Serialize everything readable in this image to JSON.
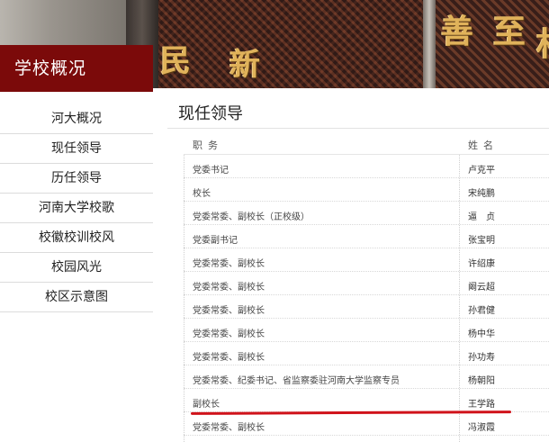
{
  "banner": {
    "glyphs": [
      "民",
      "新",
      "善",
      "至",
      "村"
    ]
  },
  "sidebar": {
    "title": "学校概况",
    "items": [
      {
        "label": "河大概况"
      },
      {
        "label": "现任领导"
      },
      {
        "label": "历任领导"
      },
      {
        "label": "河南大学校歌"
      },
      {
        "label": "校徽校训校风"
      },
      {
        "label": "校园风光"
      },
      {
        "label": "校区示意图"
      }
    ]
  },
  "main": {
    "title": "现任领导",
    "table": {
      "headers": {
        "position": "职务",
        "name": "姓名"
      },
      "rows": [
        {
          "position": "党委书记",
          "name": "卢克平"
        },
        {
          "position": "校长",
          "name": "宋纯鹏"
        },
        {
          "position": "党委常委、副校长（正校级）",
          "name": "逼　贞"
        },
        {
          "position": "党委副书记",
          "name": "张宝明"
        },
        {
          "position": "党委常委、副校长",
          "name": "许绍康"
        },
        {
          "position": "党委常委、副校长",
          "name": "阚云超"
        },
        {
          "position": "党委常委、副校长",
          "name": "孙君健"
        },
        {
          "position": "党委常委、副校长",
          "name": "杨中华"
        },
        {
          "position": "党委常委、副校长",
          "name": "孙功寿"
        },
        {
          "position": "党委常委、纪委书记、省监察委驻河南大学监察专员",
          "name": "杨朝阳"
        },
        {
          "position": "副校长",
          "name": "王学路"
        },
        {
          "position": "党委常委、副校长",
          "name": "冯淑霞"
        }
      ]
    }
  },
  "colors": {
    "accent": "#7b0a0a",
    "highlight": "#d0121a"
  }
}
